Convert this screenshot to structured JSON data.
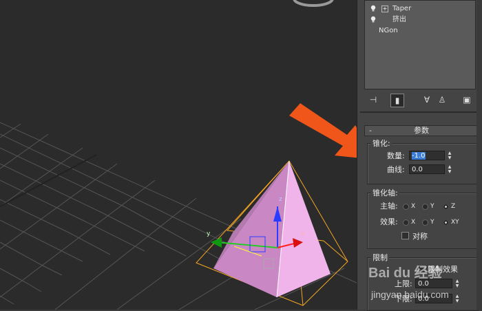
{
  "modifier_stack": {
    "items": [
      {
        "label": "Taper",
        "expandable": true
      },
      {
        "label": "挤出",
        "expandable": false
      },
      {
        "label": "NGon",
        "expandable": false
      }
    ]
  },
  "toolbar": {
    "icons": [
      "pin-stack-icon",
      "show-end-result-icon",
      "make-unique-icon",
      "remove-modifier-icon",
      "configure-modifier-sets-icon"
    ]
  },
  "parameters": {
    "rollout_title": "参数",
    "rollout_collapse": "-",
    "taper_group": {
      "title": "锥化:",
      "amount_label": "数量:",
      "amount_value": "-1.0",
      "curve_label": "曲线:",
      "curve_value": "0.0"
    },
    "taper_axis_group": {
      "title": "锥化轴:",
      "primary_label": "主轴:",
      "primary_options": [
        "X",
        "Y",
        "Z"
      ],
      "primary_selected": "Z",
      "effect_label": "效果:",
      "effect_options": [
        "X",
        "Y",
        "XY"
      ],
      "effect_selected": "XY",
      "symmetry_label": "对称",
      "symmetry_checked": false
    },
    "limits_group": {
      "title": "限制",
      "limit_effect_label": "限制效果",
      "upper_label": "上限:",
      "upper_value": "0.0",
      "lower_label": "下限:",
      "lower_value": "0.0"
    }
  },
  "gizmo": {
    "x_label": "x",
    "y_label": "y",
    "z_label": "z"
  },
  "watermark": {
    "text": "Bai du 经验",
    "url": "jingyan.baidu.com"
  },
  "colors": {
    "viewport_bg": "#2b2b2b",
    "panel_bg": "#444444",
    "pyramid_fill": "#e8a6e2",
    "bbox_orange": "#f5a623",
    "arrow_orange": "#f0561a",
    "selection_blue": "#3a7bd5"
  }
}
